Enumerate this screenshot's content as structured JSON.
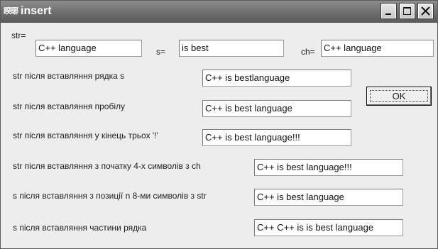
{
  "window": {
    "title": "insert",
    "icon_text": "睽琊"
  },
  "titlebar_buttons": {
    "minimize": "minimize-icon",
    "maximize": "maximize-icon",
    "close": "close-icon"
  },
  "inputs": {
    "str_label": "str=",
    "str_value": "C++ language",
    "s_label": "s=",
    "s_value": "is best",
    "ch_label": "ch=",
    "ch_value": "C++ language"
  },
  "results": [
    {
      "label": "str після вставляння рядка s",
      "value": "C++ is bestlanguage"
    },
    {
      "label": "str після вставляння пробілу",
      "value": "C++ is best language"
    },
    {
      "label": "str після вставляння у кінець трьох '!'",
      "value": "C++ is best language!!!"
    },
    {
      "label": "str після вставляння з початку 4-х символів з ch",
      "value": "C++ is best language!!!"
    },
    {
      "label": "s після вставляння з позиції n 8-ми символів з str",
      "value": "C++ is best language"
    },
    {
      "label": "s після вставляння частини рядка",
      "value": "C++ C++ is is best language"
    }
  ],
  "ok_button": {
    "label": "OK"
  }
}
